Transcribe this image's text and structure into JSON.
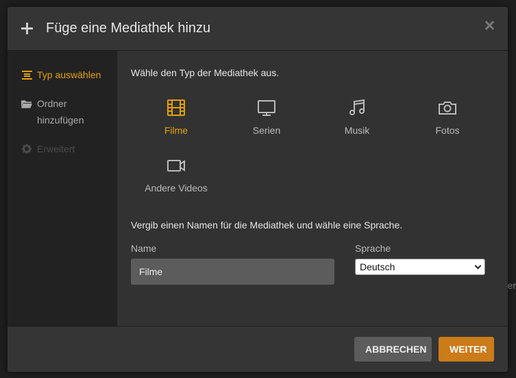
{
  "backdrop": {
    "edge_text": "er"
  },
  "dialog": {
    "title": "Füge eine Mediathek hinzu",
    "icons": {
      "add": "plus-icon",
      "close": "close-icon"
    }
  },
  "sidebar": {
    "items": [
      {
        "label": "Typ auswählen",
        "icon": "list-icon",
        "state": "active"
      },
      {
        "label": "Ordner hinzufügen",
        "icon": "folder-icon",
        "state": "normal"
      },
      {
        "label": "Erweitert",
        "icon": "gear-icon",
        "state": "disabled"
      }
    ]
  },
  "main": {
    "type_prompt": "Wähle den Typ der Mediathek aus.",
    "types": [
      {
        "label": "Filme",
        "icon": "film-icon",
        "selected": true
      },
      {
        "label": "Serien",
        "icon": "tv-icon",
        "selected": false
      },
      {
        "label": "Musik",
        "icon": "music-icon",
        "selected": false
      },
      {
        "label": "Fotos",
        "icon": "camera-icon",
        "selected": false
      },
      {
        "label": "Andere Videos",
        "icon": "video-camera-icon",
        "selected": false
      }
    ],
    "name_prompt": "Vergib einen Namen für die Mediathek und wähle eine Sprache.",
    "name_label": "Name",
    "name_value": "Filme",
    "language_label": "Sprache",
    "language_value": "Deutsch"
  },
  "footer": {
    "cancel_label": "ABBRECHEN",
    "next_label": "WEITER"
  },
  "colors": {
    "accent": "#e5a00d",
    "next_button": "#cc7b19",
    "cancel_button": "#5c5c5c",
    "header_bg": "#353535",
    "content_bg": "#323232"
  }
}
